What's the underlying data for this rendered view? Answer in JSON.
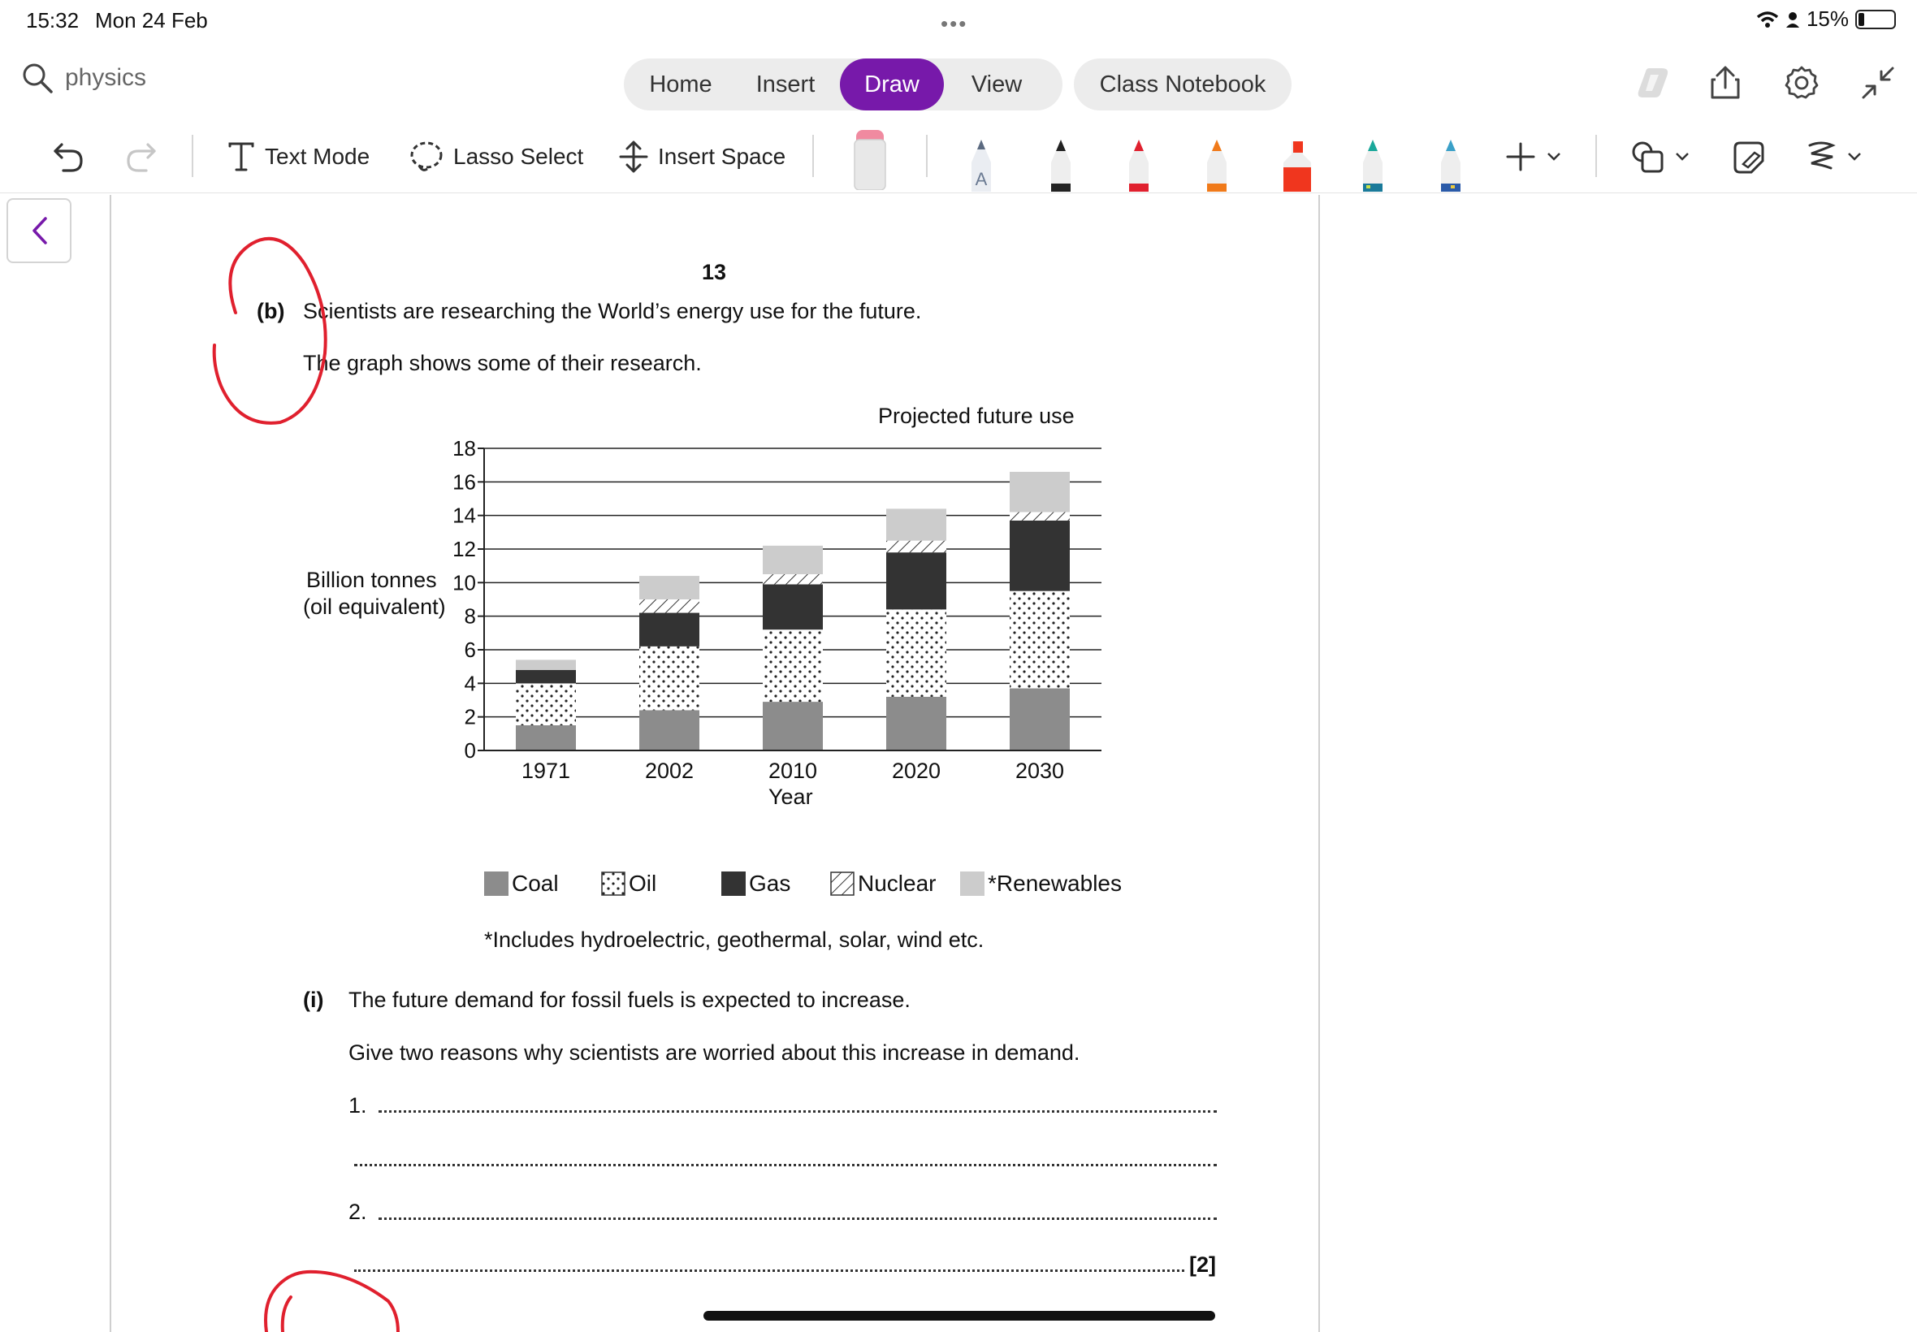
{
  "status": {
    "time": "15:32",
    "date": "Mon 24 Feb",
    "battery": "15%"
  },
  "search": {
    "text": "physics"
  },
  "tabs": [
    {
      "label": "Home",
      "active": false
    },
    {
      "label": "Insert",
      "active": false
    },
    {
      "label": "Draw",
      "active": true
    },
    {
      "label": "View",
      "active": false
    }
  ],
  "class_notebook": "Class Notebook",
  "toolbar": {
    "text_mode": "Text Mode",
    "lasso_select": "Lasso Select",
    "insert_space": "Insert Space"
  },
  "pens": [
    {
      "name": "pencil-a",
      "color": "#8a9bb3"
    },
    {
      "name": "black-pen",
      "color": "#222222"
    },
    {
      "name": "red-pen",
      "color": "#e0202e"
    },
    {
      "name": "orange-pen",
      "color": "#f07a1a"
    },
    {
      "name": "red-highlighter",
      "color": "#f0361e"
    },
    {
      "name": "galaxy-pen-green",
      "color": "#1aa89a"
    },
    {
      "name": "galaxy-pen-blue",
      "color": "#3aa0c8"
    }
  ],
  "document": {
    "page_number": "13",
    "part_label": "(b)",
    "intro_line1": "Scientists are researching the World’s energy use for the future.",
    "intro_line2": "The graph shows some of their research.",
    "footnote": "*Includes hydroelectric, geothermal, solar, wind etc.",
    "sub_label": "(i)",
    "question_line1": "The future demand for fossil fuels is expected to increase.",
    "question_line2": "Give two reasons why scientists are worried about this increase in demand.",
    "answer1_label": "1.",
    "answer2_label": "2.",
    "marks": "[2]"
  },
  "chart_data": {
    "type": "bar",
    "stacked": true,
    "annotation": "Projected future use",
    "xlabel": "Year",
    "ylabel": [
      "Billion tonnes",
      "(oil equivalent)"
    ],
    "ylim": [
      0,
      18
    ],
    "yticks": [
      0,
      2,
      4,
      6,
      8,
      10,
      12,
      14,
      16,
      18
    ],
    "grid": true,
    "categories": [
      "1971",
      "2002",
      "2010",
      "2020",
      "2030"
    ],
    "series": [
      {
        "name": "Coal",
        "pattern": "solid",
        "color": "#8c8c8c",
        "values": [
          1.5,
          2.4,
          2.9,
          3.2,
          3.7
        ]
      },
      {
        "name": "Oil",
        "pattern": "dots",
        "color": "#ffffff",
        "values": [
          2.5,
          3.8,
          4.3,
          5.2,
          5.8
        ]
      },
      {
        "name": "Gas",
        "pattern": "solid",
        "color": "#333333",
        "values": [
          0.8,
          2.0,
          2.7,
          3.4,
          4.2
        ]
      },
      {
        "name": "Nuclear",
        "pattern": "hatch",
        "color": "#ffffff",
        "values": [
          0.0,
          0.8,
          0.6,
          0.7,
          0.5
        ]
      },
      {
        "name": "*Renewables",
        "pattern": "solid",
        "color": "#cccccc",
        "values": [
          0.6,
          1.4,
          1.7,
          1.9,
          2.4
        ]
      }
    ],
    "legend_position": "bottom"
  }
}
